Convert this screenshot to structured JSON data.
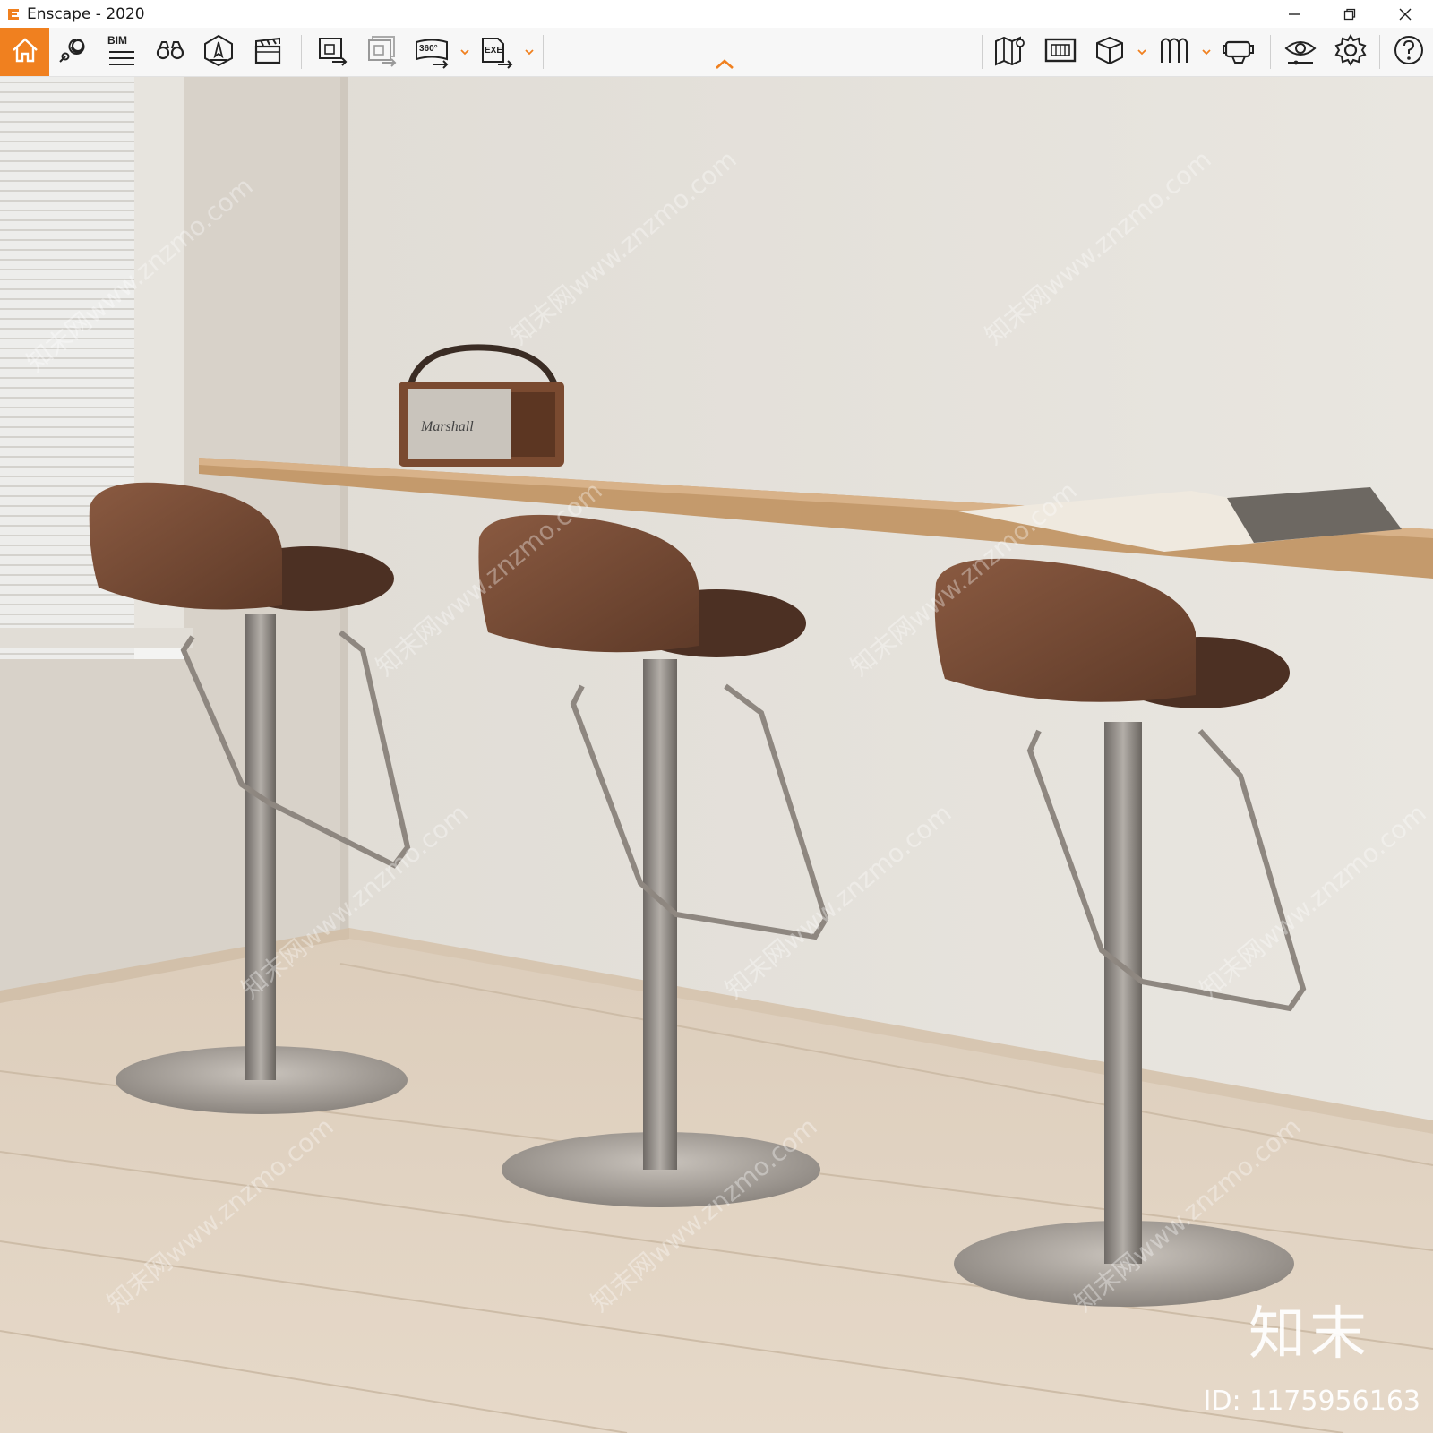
{
  "window": {
    "title": "Enscape - 2020",
    "controls": [
      "minimize",
      "restore",
      "close"
    ]
  },
  "toolbar": {
    "bim_label": "BIM",
    "panorama_label": "360°",
    "exe_label": "EXE",
    "accent_color": "#f0801f",
    "icons": [
      "home-icon",
      "location-pin-icon",
      "bim-icon",
      "binoculars-icon",
      "compass-icon",
      "clapper-icon",
      "export-image-icon",
      "batch-render-icon",
      "panorama-icon",
      "exe-export-icon",
      "map-icon",
      "asset-library-icon",
      "cube-icon",
      "material-icon",
      "vr-headset-icon",
      "visual-settings-icon",
      "settings-icon",
      "help-icon"
    ]
  },
  "viewport": {
    "watermark_logo": "知末",
    "watermark_id": "ID: 1175956163",
    "watermark_text": "知末网www.znzmo.com",
    "speaker_label": "Marshall"
  }
}
